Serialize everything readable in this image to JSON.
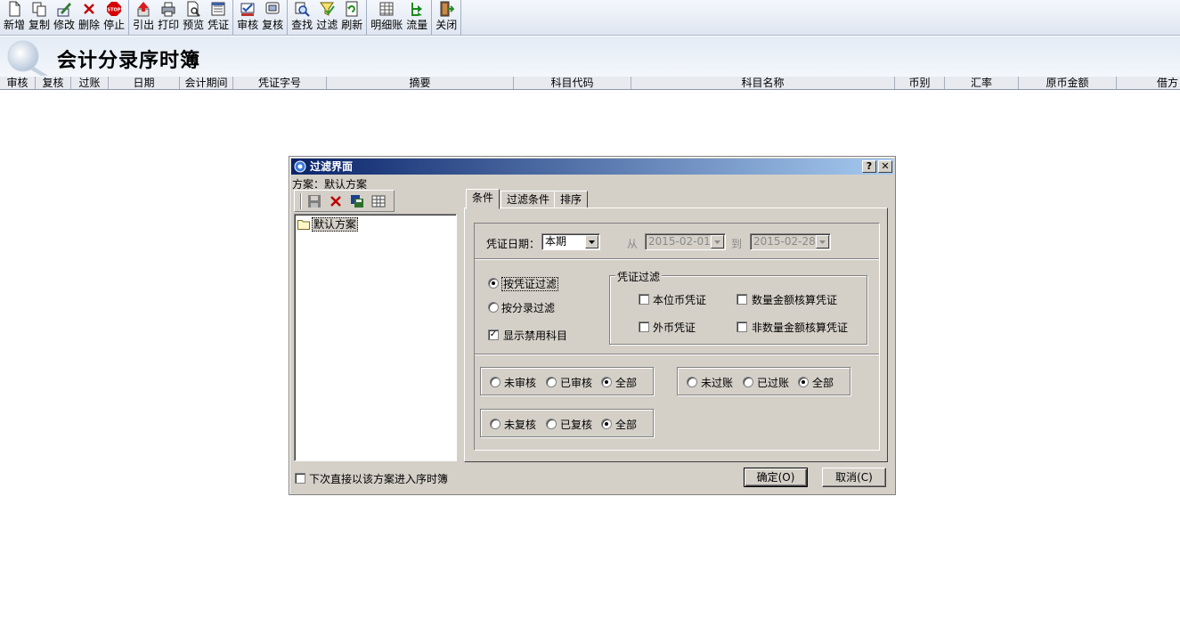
{
  "toolbar": {
    "groups": [
      [
        {
          "name": "new-button",
          "icon": "new-doc-icon",
          "label": "新增"
        },
        {
          "name": "copy-button",
          "icon": "copy-icon",
          "label": "复制"
        },
        {
          "name": "edit-button",
          "icon": "edit-icon",
          "label": "修改"
        },
        {
          "name": "delete-button",
          "icon": "delete-icon",
          "label": "删除"
        },
        {
          "name": "stop-button",
          "icon": "stop-icon",
          "label": "停止"
        }
      ],
      [
        {
          "name": "export-button",
          "icon": "export-icon",
          "label": "引出"
        },
        {
          "name": "print-button",
          "icon": "print-icon",
          "label": "打印"
        },
        {
          "name": "preview-button",
          "icon": "preview-icon",
          "label": "预览"
        },
        {
          "name": "voucher-button",
          "icon": "voucher-icon",
          "label": "凭证"
        }
      ],
      [
        {
          "name": "audit-button",
          "icon": "audit-icon",
          "label": "审核"
        },
        {
          "name": "recheck-button",
          "icon": "recheck-icon",
          "label": "复核"
        }
      ],
      [
        {
          "name": "find-button",
          "icon": "find-icon",
          "label": "查找"
        },
        {
          "name": "filter-button",
          "icon": "filter-icon",
          "label": "过滤"
        },
        {
          "name": "refresh-button",
          "icon": "refresh-icon",
          "label": "刷新"
        }
      ],
      [
        {
          "name": "detail-ledger-button",
          "icon": "detail-ledger-icon",
          "label": "明细账"
        },
        {
          "name": "flow-button",
          "icon": "flow-icon",
          "label": "流量"
        }
      ],
      [
        {
          "name": "close-button",
          "icon": "exit-door-icon",
          "label": "关闭"
        }
      ]
    ]
  },
  "page": {
    "title": "会计分录序时簿"
  },
  "grid": {
    "columns": [
      "审核",
      "复核",
      "过账",
      "日期",
      "会计期间",
      "凭证字号",
      "摘要",
      "科目代码",
      "科目名称",
      "币别",
      "汇率",
      "原币金额",
      "借方"
    ]
  },
  "dialog": {
    "title": "过滤界面",
    "help_label": "?",
    "close_label": "✕",
    "scheme_label": "方案：默认方案",
    "tree_item": "默认方案",
    "tabs": [
      "条件",
      "过滤条件",
      "排序"
    ],
    "date_label": "凭证日期：",
    "date_period": "本期",
    "from_label": "从",
    "from_date": "2015-02-01",
    "to_label": "到",
    "to_date": "2015-02-28",
    "filter_by_voucher": "按凭证过滤",
    "filter_by_entry": "按分录过滤",
    "show_disabled_accounts": "显示禁用科目",
    "voucher_filter_group": "凭证过滤",
    "cb_local_currency": "本位币凭证",
    "cb_qty_amount": "数量金额核算凭证",
    "cb_foreign_currency": "外币凭证",
    "cb_non_qty_amount": "非数量金额核算凭证",
    "audit_options": [
      "未审核",
      "已审核",
      "全部"
    ],
    "post_options": [
      "未过账",
      "已过账",
      "全部"
    ],
    "recheck_options": [
      "未复核",
      "已复核",
      "全部"
    ],
    "direct_enter_label": "下次直接以该方案进入序时簿",
    "ok_label": "确定(O)",
    "cancel_label": "取消(C)"
  },
  "colors": {
    "title_bar_start": "#0a246a",
    "title_bar_end": "#a6caf0",
    "dialog_bg": "#d4d0c8"
  }
}
